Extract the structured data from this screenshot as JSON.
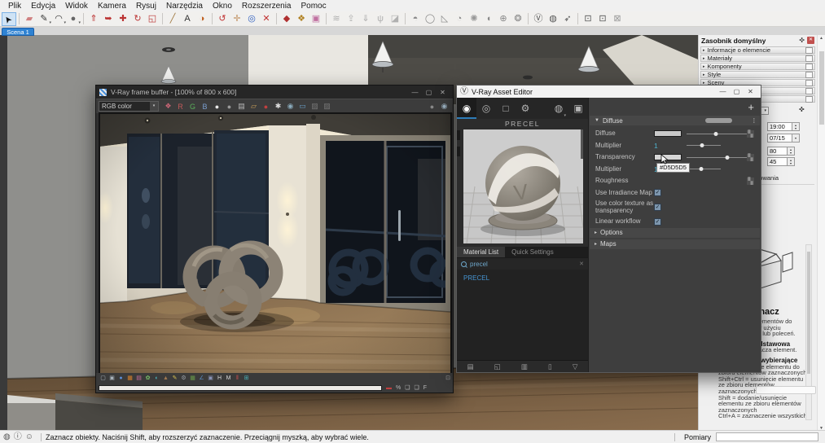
{
  "menu_items": [
    "Plik",
    "Edycja",
    "Widok",
    "Kamera",
    "Rysuj",
    "Narzędzia",
    "Okno",
    "Rozszerzenia",
    "Pomoc"
  ],
  "scene_tab": "Scena 1",
  "glyphs": {
    "caret": "▾",
    "spin_up": "▴",
    "spin_down": "▾",
    "arrow_right": "▸",
    "arrow_down": "▼",
    "up": "▲",
    "down": "▼",
    "dots": "⋮",
    "ellipsis": "⁞",
    "plus": "+",
    "check": "✓",
    "slot": "▚",
    "pin": "✜",
    "close": "✕",
    "min": "—",
    "max": "▢",
    "logo": "Ⓥ"
  },
  "colors": {
    "accent_blue": "#2f83d3",
    "value_cyan": "#4fb3cf",
    "material_link": "#4694d1",
    "close_red": "#c1504e",
    "tab_underline": "#2e7cb8"
  },
  "main_toolbar": [
    {
      "name": "select-tool",
      "glyph": "➤",
      "color": "#111",
      "active": true
    },
    {
      "sep": true
    },
    {
      "name": "eraser-tool",
      "glyph": "▰",
      "color": "#d08080"
    },
    {
      "name": "pencil-tool",
      "glyph": "✎",
      "color": "#333",
      "caret": true
    },
    {
      "name": "arc-tool",
      "glyph": "◠",
      "color": "#333",
      "caret": true
    },
    {
      "name": "circle-tool",
      "glyph": "●",
      "color": "#666",
      "caret": true
    },
    {
      "sep": true
    },
    {
      "name": "push-pull-tool",
      "glyph": "⇑",
      "color": "#b33"
    },
    {
      "name": "follow-me-tool",
      "glyph": "➥",
      "color": "#b33"
    },
    {
      "name": "move-tool",
      "glyph": "✚",
      "color": "#b33"
    },
    {
      "name": "rotate-tool",
      "glyph": "↻",
      "color": "#b33"
    },
    {
      "name": "scale-tool",
      "glyph": "◱",
      "color": "#b33"
    },
    {
      "sep": true
    },
    {
      "name": "tape-measure-tool",
      "glyph": "╱",
      "color": "#a07840"
    },
    {
      "name": "text-tool",
      "glyph": "A",
      "color": "#333"
    },
    {
      "name": "paint-bucket-tool",
      "glyph": "◑",
      "color": "#c06020"
    },
    {
      "sep": true
    },
    {
      "name": "orbit-tool",
      "glyph": "↺",
      "color": "#c03030"
    },
    {
      "name": "pan-tool",
      "glyph": "✛",
      "color": "#c09060"
    },
    {
      "name": "zoom-tool",
      "glyph": "◎",
      "color": "#3060c0"
    },
    {
      "name": "zoom-extents-tool",
      "glyph": "✕",
      "color": "#c03030"
    },
    {
      "sep": true
    },
    {
      "name": "component-tool",
      "glyph": "◆",
      "color": "#b03030"
    },
    {
      "name": "paint-palette-tool",
      "glyph": "❖",
      "color": "#b08020"
    },
    {
      "name": "export-tool",
      "glyph": "▣",
      "color": "#c070a0"
    },
    {
      "sep": true
    },
    {
      "name": "soften-edges-tool",
      "glyph": "≋",
      "color": "#b0b0b0"
    },
    {
      "name": "outer-shell-tool",
      "glyph": "⇪",
      "color": "#b0b0b0"
    },
    {
      "name": "solid-tools",
      "glyph": "⇓",
      "color": "#b0b0b0"
    },
    {
      "name": "vegetation-tool",
      "glyph": "ψ",
      "color": "#b0b0b0"
    },
    {
      "name": "sandbox-tool",
      "glyph": "◪",
      "color": "#b0b0b0"
    },
    {
      "sep": true
    },
    {
      "name": "vray-infinite-plane",
      "glyph": "◓",
      "color": "#888"
    },
    {
      "name": "vray-sphere-light",
      "glyph": "◯",
      "color": "#888"
    },
    {
      "name": "vray-rectangle-light",
      "glyph": "◺",
      "color": "#888"
    },
    {
      "name": "vray-spot-light",
      "glyph": "◔",
      "color": "#888"
    },
    {
      "name": "vray-omni-light",
      "glyph": "✺",
      "color": "#999"
    },
    {
      "name": "vray-dome-light",
      "glyph": "◖",
      "color": "#888"
    },
    {
      "name": "vray-mesh-light",
      "glyph": "⊕",
      "color": "#888"
    },
    {
      "name": "vray-ies-light",
      "glyph": "❂",
      "color": "#888"
    },
    {
      "sep": true
    },
    {
      "name": "vray-asset-editor-button",
      "glyph": "Ⓥ",
      "color": "#555"
    },
    {
      "name": "vray-render-button",
      "glyph": "◍",
      "color": "#555"
    },
    {
      "name": "vray-interactive-render-button",
      "glyph": "➶",
      "color": "#555"
    },
    {
      "sep": true
    },
    {
      "name": "vray-frame-buffer-button",
      "glyph": "⊡",
      "color": "#555"
    },
    {
      "name": "vray-batch-render-button",
      "glyph": "⊡",
      "color": "#555"
    },
    {
      "name": "vray-lock-button",
      "glyph": "⊠",
      "color": "#999"
    }
  ],
  "vfb": {
    "title": "V-Ray frame buffer - [100% of 800 x 600]",
    "channel": "RGB color",
    "tools": [
      {
        "name": "color-corrections-icon",
        "glyph": "❖",
        "color": "#cc6677"
      },
      {
        "name": "red-channel-icon",
        "glyph": "R",
        "color": "#c05a5a"
      },
      {
        "name": "green-channel-icon",
        "glyph": "G",
        "color": "#5ab05a"
      },
      {
        "name": "blue-channel-icon",
        "glyph": "B",
        "color": "#7a9fd0"
      },
      {
        "name": "rgb-channel-icon",
        "glyph": "●",
        "color": "#e8e8e8"
      },
      {
        "name": "alpha-channel-icon",
        "glyph": "●",
        "color": "#9a9a9a"
      },
      {
        "name": "save-image-icon",
        "glyph": "▤",
        "color": "#b9b9b9"
      },
      {
        "name": "load-image-icon",
        "glyph": "▱",
        "color": "#caa05a"
      },
      {
        "name": "record-icon",
        "glyph": "●",
        "color": "#c04040"
      },
      {
        "name": "track-mouse-icon",
        "glyph": "✱",
        "color": "#dddddd"
      },
      {
        "name": "region-render-icon",
        "glyph": "◉",
        "color": "#8aabbc"
      },
      {
        "name": "monitor-icon",
        "glyph": "▭",
        "color": "#6aa0c8"
      },
      {
        "name": "stereo-icon",
        "glyph": "▨",
        "color": "#777777"
      },
      {
        "name": "compare-icon",
        "glyph": "▨",
        "color": "#777777"
      }
    ],
    "tools_right": [
      {
        "name": "render-last-icon",
        "glyph": "●",
        "color": "#888888"
      },
      {
        "name": "follow-mouse-icon",
        "glyph": "◉",
        "color": "#9ab0c0"
      }
    ],
    "cc_tools": [
      {
        "name": "force-color-clamping-icon",
        "glyph": "▢",
        "color": "#aab4bc"
      },
      {
        "name": "view-clamped-colors-icon",
        "glyph": "▣",
        "color": "#aab4bc"
      },
      {
        "name": "pixel-aspect-icon",
        "glyph": "●",
        "color": "#5b8dd6"
      },
      {
        "name": "color-balance-icon",
        "glyph": "▦",
        "color": "#d9822b"
      },
      {
        "name": "hue-saturation-icon",
        "glyph": "▤",
        "color": "#cc6fa0"
      },
      {
        "name": "color-correction-icon",
        "glyph": "✿",
        "color": "#7ac36a"
      },
      {
        "name": "exposure-icon",
        "glyph": "◐",
        "color": "#49b0b8"
      },
      {
        "name": "background-image-icon",
        "glyph": "▲",
        "color": "#a07850"
      },
      {
        "name": "stamp-icon",
        "glyph": "✎",
        "color": "#d8c050"
      },
      {
        "name": "settings-icon",
        "glyph": "⚙",
        "color": "#9aa0a6"
      },
      {
        "name": "lut-icon",
        "glyph": "▦",
        "color": "#6a9a4a"
      },
      {
        "name": "curve-icon",
        "glyph": "∠",
        "color": "#5a8ac0"
      },
      {
        "name": "icc-icon",
        "glyph": "▣",
        "color": "#8a94b8"
      },
      {
        "name": "histogram-icon",
        "glyph": "H",
        "color": "#d8d8d8"
      },
      {
        "name": "waveform-icon",
        "glyph": "M",
        "color": "#d8d8d8"
      },
      {
        "name": "rgb-parade-icon",
        "glyph": "‖",
        "color": "#d05050"
      },
      {
        "name": "pixel-information-icon",
        "glyph": "⊞",
        "color": "#49b0b8"
      }
    ],
    "progress_icons": [
      {
        "name": "stop-render-icon",
        "glyph": "▬",
        "color": "#c04040"
      },
      {
        "name": "percent-icon",
        "glyph": "%",
        "color": "#b8b8b8"
      },
      {
        "name": "message-window-icon",
        "glyph": "❑",
        "color": "#b8b8b8"
      },
      {
        "name": "log-window-icon",
        "glyph": "❑",
        "color": "#b8b8b8"
      },
      {
        "name": "f-stop-icon",
        "glyph": "F",
        "color": "#b8b8b8"
      }
    ]
  },
  "asset_editor": {
    "title": "V-Ray Asset Editor",
    "preview_name": "PRECEL",
    "top_tabs": [
      {
        "name": "materials-tab",
        "glyph": "◉",
        "active": true
      },
      {
        "name": "lights-tab",
        "glyph": "◎",
        "active": false
      },
      {
        "name": "geometry-tab",
        "glyph": "□",
        "active": false
      },
      {
        "name": "settings-tab",
        "glyph": "⚙",
        "active": false
      }
    ],
    "render_buttons": [
      {
        "name": "render-with-vray-button",
        "glyph": "◍",
        "caret": true
      },
      {
        "name": "frame-buffer-button",
        "glyph": "▣",
        "caret": false
      }
    ],
    "sub_tabs": [
      {
        "label": "Material List",
        "active": true
      },
      {
        "label": "Quick Settings",
        "active": false
      }
    ],
    "search_value": "precel",
    "materials": [
      "PRECEL"
    ],
    "footer_icons": [
      {
        "name": "add-material-icon",
        "glyph": "▤"
      },
      {
        "name": "import-material-icon",
        "glyph": "◱"
      },
      {
        "name": "save-material-icon",
        "glyph": "▥"
      },
      {
        "name": "remove-material-icon",
        "glyph": "▯"
      },
      {
        "name": "purge-unused-icon",
        "glyph": "▽"
      }
    ],
    "panel": {
      "section_header": "Diffuse",
      "rows": [
        {
          "label": "Diffuse",
          "swatch": "#c9c9c9",
          "slider": 0.49,
          "wide": true,
          "slot": true
        },
        {
          "label": "Multiplier",
          "value": "1",
          "slider": 0.46
        },
        {
          "label": "Transparency",
          "swatch": "#d5d5d5",
          "slider": 0.67,
          "wide": true,
          "slot": true,
          "cursor": true
        },
        {
          "label": "Multiplier",
          "value": "1",
          "slider": 0.44
        },
        {
          "label": "Roughness",
          "slot": true
        },
        {
          "label": "Use Irradiance Map",
          "check": true
        },
        {
          "label": "Use color texture as transparency",
          "check": true,
          "tall": true
        },
        {
          "label": "Linear workflow",
          "check": true
        }
      ],
      "tooltip": "#D5D5D5",
      "collapsed_sections": [
        "Options",
        "Maps"
      ]
    }
  },
  "tray": {
    "title": "Zasobnik domyślny",
    "sections": [
      "Informacje o elemencie",
      "Materiały",
      "Komponenty",
      "Style",
      "Sceny"
    ],
    "hidden_section_count": 2,
    "shadows": {
      "time": "19:00",
      "date": "07/15",
      "light": "80",
      "dark": "45",
      "use_sun_label": "Użyj słońca do cieniowania"
    },
    "instructor": {
      "title": "Zaznacz",
      "lines": [
        {
          "text": "zaznaczania elementów do",
          "bold": false
        },
        {
          "text": "modyfikacji przy użyciu",
          "bold": false
        },
        {
          "text": "innych narzędzi lub poleceń.",
          "bold": false
        },
        {
          "text": "Czynność podstawowa",
          "bold": true
        },
        {
          "text": "Kliknięcie zaznacza element.",
          "bold": false
        },
        {
          "text": "Modyfikatory wybierające",
          "bold": true
        },
        {
          "text": "Ctrl = dodawanie elementu do",
          "bold": false
        },
        {
          "text": "zbioru elementów zaznaczonych",
          "bold": false
        },
        {
          "text": "Shift+Ctrl = usunięcie elementu",
          "bold": false
        },
        {
          "text": "ze zbioru elementów",
          "bold": false
        },
        {
          "text": "zaznaczonych",
          "bold": false
        },
        {
          "text": "Shift = dodanie/usunięcie",
          "bold": false
        },
        {
          "text": "elementu ze zbioru elementów",
          "bold": false
        },
        {
          "text": "zaznaczonych",
          "bold": false
        },
        {
          "text": "Ctrl+A = zaznaczenie wszystkich",
          "bold": false
        }
      ]
    }
  },
  "status": {
    "icons": [
      {
        "name": "geolocation-icon",
        "glyph": "◍"
      },
      {
        "name": "credits-icon",
        "glyph": "ⓘ"
      },
      {
        "name": "claim-icon",
        "glyph": "☺"
      }
    ],
    "message": "Zaznacz obiekty. Naciśnij Shift, aby rozszerzyć zaznaczenie. Przeciągnij myszką, aby wybrać wiele.",
    "measurements_label": "Pomiary",
    "measurements_value": ""
  }
}
